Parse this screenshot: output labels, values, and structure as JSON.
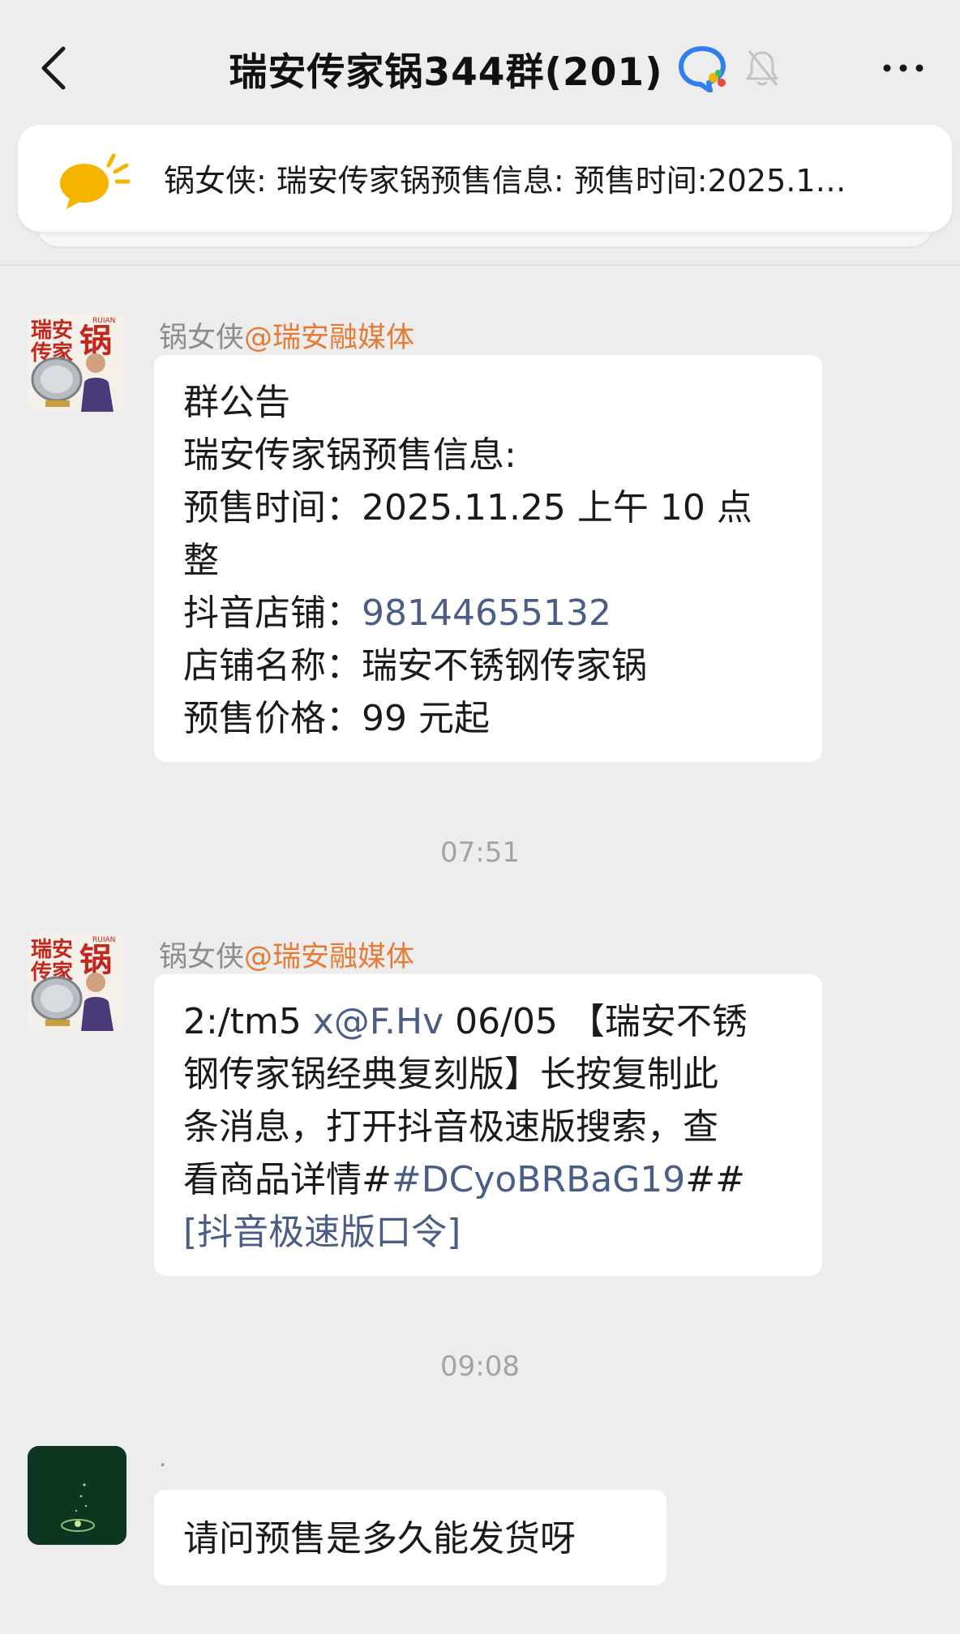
{
  "header": {
    "title": "瑞安传家锅344群(201)",
    "icons": [
      "back-chevron-icon",
      "group-badge-icon",
      "bell-muted-icon",
      "more-icon"
    ]
  },
  "pinned": {
    "icon": "megaphone-icon",
    "text": "锅女侠: 瑞安传家锅预售信息:  预售时间:2025.1…"
  },
  "messages": [
    {
      "sender_name": "锅女侠",
      "sender_org": "@瑞安融媒体",
      "lines": [
        "群公告",
        "瑞安传家锅预售信息:",
        "预售时间：2025.11.25 上午 10 点",
        "整",
        "抖音店铺：",
        "98144655132",
        "店铺名称：瑞安不锈钢传家锅",
        "预售价格：99 元起"
      ]
    },
    {
      "sender_name": "锅女侠",
      "sender_org": "@瑞安融媒体",
      "lines": [
        "2:/tm5 ",
        "x@F.Hv",
        " 06/05 【瑞安不锈",
        "钢传家锅经典复刻版】长按复制此",
        "条消息，打开抖音极速版搜索，查",
        "看商品详情#",
        "#DCyoBRBaG19",
        "##",
        "[抖音极速版口令]"
      ]
    },
    {
      "sender_name": ".",
      "lines": [
        "请问预售是多久能发货呀"
      ]
    }
  ],
  "times": [
    "07:51",
    "09:08"
  ],
  "avatar_text": [
    "瑞安",
    "传家",
    "锅",
    "RUIAN"
  ],
  "colors": {
    "background": "#ededed",
    "bubble": "#ffffff",
    "link": "#4a5d85",
    "sender_org": "#e67b37",
    "pinned_icon": "#f5b400"
  }
}
